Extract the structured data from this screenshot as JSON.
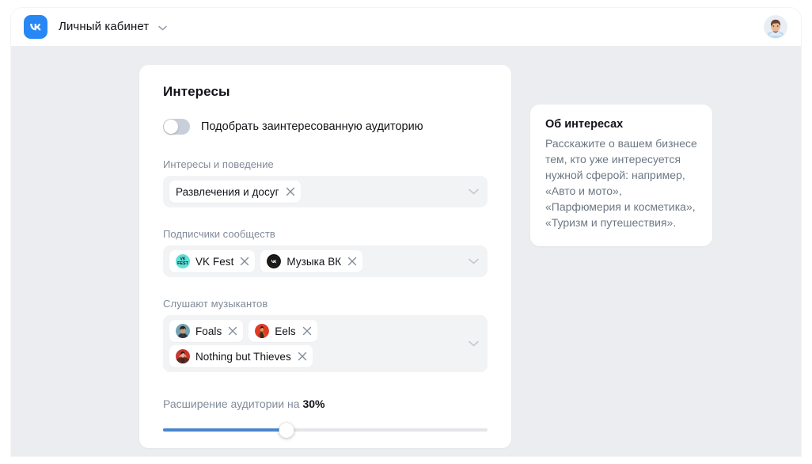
{
  "topbar": {
    "logo_icon": "vk-logo-icon",
    "title": "Личный кабинет",
    "chevron_icon": "chevron-down-icon",
    "avatar_icon": "user-avatar"
  },
  "main": {
    "title": "Интересы",
    "toggle": {
      "label": "Подобрать заинтересованную аудиторию",
      "state": "off"
    },
    "fields": [
      {
        "label": "Интересы и поведение",
        "name": "interests-and-behaviour",
        "chevron_icon": "chevron-down-icon",
        "chips": [
          {
            "label": "Развлечения и досуг",
            "avatar": "none",
            "close_icon": "close-icon"
          }
        ]
      },
      {
        "label": "Подписчики сообществ",
        "name": "community-subscribers",
        "chevron_icon": "chevron-down-icon",
        "chips": [
          {
            "label": "VK Fest",
            "avatar": "vkfest",
            "close_icon": "close-icon"
          },
          {
            "label": "Музыка ВК",
            "avatar": "vkmusic",
            "close_icon": "close-icon"
          }
        ]
      },
      {
        "label": "Слушают музыкантов",
        "name": "listen-to-musicians",
        "chevron_icon": "chevron-down-icon",
        "chips": [
          {
            "label": "Foals",
            "avatar": "foals",
            "close_icon": "close-icon"
          },
          {
            "label": "Eels",
            "avatar": "eels",
            "close_icon": "close-icon"
          },
          {
            "label": "Nothing but Thieves",
            "avatar": "thieves",
            "close_icon": "close-icon"
          }
        ]
      }
    ],
    "slider": {
      "caption_prefix": "Расширение аудитории на ",
      "value_label": "30%",
      "value": 30,
      "min": 0,
      "max": 100,
      "fill_percent": 38,
      "fill_color": "#4986CC",
      "track_color": "#E3E5E8"
    }
  },
  "info_card": {
    "title": "Об интересах",
    "text": "Расскажите о вашем бизнесе тем, кто уже интересуется нужной сферой: например, «Авто и мото», «Парфюмерия и косметика», «Туризм и путешествия»."
  },
  "colors": {
    "brand_blue": "#2787F5",
    "page_bg": "#EBEDF0",
    "card_bg": "#FFFFFF",
    "field_bg": "#F2F3F5",
    "muted_text": "#818C99",
    "body_text": "#111318"
  }
}
